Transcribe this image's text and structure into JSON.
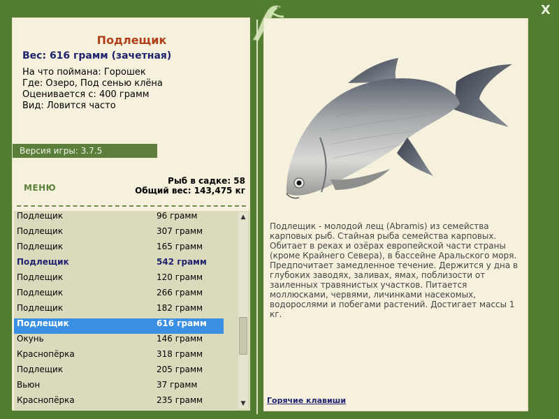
{
  "window": {
    "close_label": "X"
  },
  "fish": {
    "title": "Подлещик",
    "weight_line": "Вес: 616 грамм (зачетная)",
    "info_lines": [
      "На что поймана: Горошек",
      "Где: Озеро, Под сенью клёна",
      "Оценивается с: 400 грамм",
      "Вид: Ловится часто"
    ],
    "description": "Подлещик - молодой лещ (Abramis) из семейства карповых рыб. Стайная рыба семейства карповых. Обитает в реках и озёрах европейской части страны (кроме Крайнего Севера), в бассейне Аральского моря. Предпочитает замедленное течение. Держится у дна в глубоких заводях, заливах, ямах, поблизости от заиленных травянистых участков. Питается моллюсками, червями, личинками насекомых, водорослями и побегами растений. Достигает массы 1 кг."
  },
  "version_label": "Версия игры: 3.7.5",
  "menu_label": "МЕНЮ",
  "stats": {
    "fish_count": "Рыб в садке: 58",
    "total_weight": "Общий вес: 143,475 кг"
  },
  "catch_list": [
    {
      "name": "Подлещик",
      "weight": "96 грамм",
      "style": "normal"
    },
    {
      "name": "Подлещик",
      "weight": "307 грамм",
      "style": "normal"
    },
    {
      "name": "Подлещик",
      "weight": "165 грамм",
      "style": "normal"
    },
    {
      "name": "Подлещик",
      "weight": "542 грамм",
      "style": "bold"
    },
    {
      "name": "Подлещик",
      "weight": "120 грамм",
      "style": "normal"
    },
    {
      "name": "Подлещик",
      "weight": "266 грамм",
      "style": "normal"
    },
    {
      "name": "Подлещик",
      "weight": "182 грамм",
      "style": "normal"
    },
    {
      "name": "Подлещик",
      "weight": "616 грамм",
      "style": "selected"
    },
    {
      "name": "Окунь",
      "weight": "146 грамм",
      "style": "normal"
    },
    {
      "name": "Краснопёрка",
      "weight": "318 грамм",
      "style": "normal"
    },
    {
      "name": "Подлещик",
      "weight": "205 грамм",
      "style": "normal"
    },
    {
      "name": "Вьюн",
      "weight": "37 грамм",
      "style": "normal"
    },
    {
      "name": "Краснопёрка",
      "weight": "235 грамм",
      "style": "normal"
    }
  ],
  "hotkeys_label": "Горячие клавиши",
  "colors": {
    "frame": "#527d31",
    "panel": "#f5f1dc",
    "title": "#b0401a",
    "accent_blue": "#1f236f",
    "selection": "#3a8fe3"
  },
  "icons": {
    "close": "close-icon",
    "logo": "fish-logo-icon",
    "scroll_up": "chevron-up-icon",
    "scroll_down": "chevron-down-icon"
  }
}
